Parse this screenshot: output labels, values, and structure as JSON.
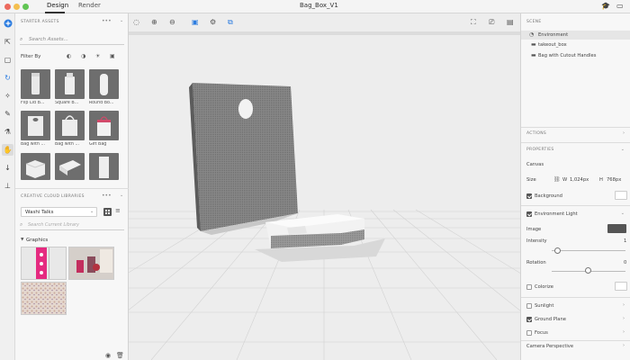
{
  "tabs": {
    "design": "Design",
    "render": "Render"
  },
  "window_title": "Bag_Box_V1",
  "left_panel": {
    "starter_assets_heading": "STARTER ASSETS",
    "search_placeholder": "Search Assets...",
    "filter_by": "Filter By",
    "assets": [
      {
        "label": "Flip Lid B..."
      },
      {
        "label": "Square B..."
      },
      {
        "label": "Round Bo..."
      },
      {
        "label": "Bag with ..."
      },
      {
        "label": "Bag with ..."
      },
      {
        "label": "Gift Bag"
      }
    ],
    "cc_libraries_heading": "CREATIVE CLOUD LIBRARIES",
    "library_name": "Washi Talks",
    "library_search_placeholder": "Search Current Library",
    "graphics_heading": "Graphics"
  },
  "right_panel": {
    "scene_heading": "SCENE",
    "scene_items": [
      "Environment",
      "takeout_box",
      "Bag with Cutout Handles"
    ],
    "actions_heading": "ACTIONS",
    "properties_heading": "PROPERTIES",
    "canvas_label": "Canvas",
    "size_label": "Size",
    "width_label": "W",
    "width_value": "1,024px",
    "height_label": "H",
    "height_value": "768px",
    "background_label": "Background",
    "env_light_label": "Environment Light",
    "image_label": "Image",
    "intensity_label": "Intensity",
    "intensity_value": "1",
    "intensity_fraction": 0.08,
    "rotation_label": "Rotation",
    "rotation_value": "0",
    "rotation_fraction": 0.5,
    "colorize_label": "Colorize",
    "sunlight_label": "Sunlight",
    "ground_plane_label": "Ground Plane",
    "focus_label": "Focus",
    "camera_perspective_label": "Camera Perspective"
  }
}
